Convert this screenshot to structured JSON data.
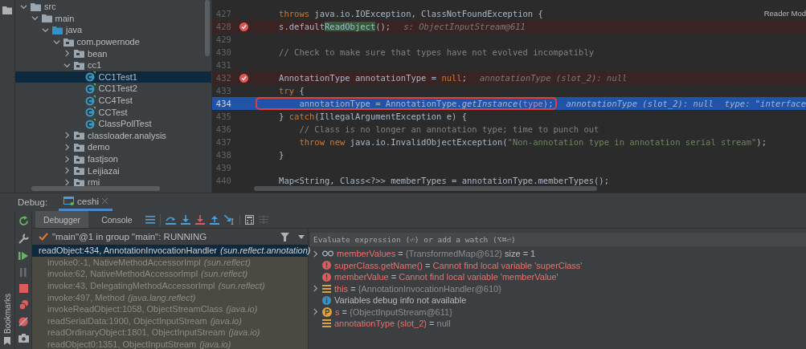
{
  "project_tree": {
    "items": [
      {
        "label": "src",
        "kind": "folder",
        "expanded": true,
        "children": [
          {
            "label": "main",
            "kind": "folder",
            "expanded": true,
            "children": [
              {
                "label": "java",
                "kind": "source_folder",
                "expanded": true,
                "children": [
                  {
                    "label": "com.powernode",
                    "kind": "package",
                    "expanded": true,
                    "children": [
                      {
                        "label": "bean",
                        "kind": "package",
                        "expanded": false,
                        "selected": false
                      },
                      {
                        "label": "cc1",
                        "kind": "package",
                        "expanded": true,
                        "selected": false,
                        "children": [
                          {
                            "label": "CC1Test1",
                            "kind": "class",
                            "selected": true
                          },
                          {
                            "label": "CC1Test2",
                            "kind": "class",
                            "selected": false
                          },
                          {
                            "label": "CC4Test",
                            "kind": "class",
                            "selected": false
                          },
                          {
                            "label": "CCTest",
                            "kind": "class",
                            "selected": false
                          },
                          {
                            "label": "ClassPollTest",
                            "kind": "class",
                            "selected": false
                          }
                        ]
                      },
                      {
                        "label": "classloader.analysis",
                        "kind": "package",
                        "expanded": false,
                        "selected": false
                      },
                      {
                        "label": "demo",
                        "kind": "package",
                        "expanded": false,
                        "selected": false
                      },
                      {
                        "label": "fastjson",
                        "kind": "package",
                        "expanded": false,
                        "selected": false
                      },
                      {
                        "label": "Leijiazai",
                        "kind": "package",
                        "expanded": false,
                        "selected": false
                      },
                      {
                        "label": "rmi",
                        "kind": "package",
                        "expanded": false,
                        "selected": false
                      }
                    ]
                  }
                ]
              }
            ]
          }
        ]
      }
    ]
  },
  "editor": {
    "reader_mode": "Reader Mod",
    "lines": [
      {
        "number": "427",
        "breakpoint": false,
        "current": false,
        "code": [
          {
            "text": "    throws",
            "kind": "keyword"
          },
          {
            "text": " java.io.IOException, ClassNotFoundException {",
            "kind": "plain"
          }
        ]
      },
      {
        "number": "428",
        "breakpoint": true,
        "current": false,
        "code": [
          {
            "text": "    s.default",
            "kind": "plain"
          },
          {
            "text": "ReadObject",
            "kind": "match"
          },
          {
            "text": "();",
            "kind": "plain"
          }
        ],
        "hints": [
          "s: ObjectInputStream@611"
        ]
      },
      {
        "number": "429",
        "breakpoint": false,
        "current": false
      },
      {
        "number": "430",
        "breakpoint": false,
        "current": false,
        "code": [
          {
            "text": "    // Check to make sure that types have not evolved incompatibly",
            "kind": "comment"
          }
        ]
      },
      {
        "number": "431",
        "breakpoint": false,
        "current": false
      },
      {
        "number": "432",
        "breakpoint": true,
        "current": false,
        "code": [
          {
            "text": "    AnnotationType annotationType = ",
            "kind": "plain"
          },
          {
            "text": "null",
            "kind": "keyword"
          },
          {
            "text": ";",
            "kind": "plain"
          }
        ],
        "hints": [
          "annotationType (slot_2): null"
        ]
      },
      {
        "number": "433",
        "breakpoint": false,
        "current": false,
        "code": [
          {
            "text": "    try",
            "kind": "keyword"
          },
          {
            "text": " {",
            "kind": "plain"
          }
        ]
      },
      {
        "number": "434",
        "breakpoint": false,
        "current": true,
        "boxed": true,
        "code": [
          {
            "text": "        annotationType = AnnotationType.",
            "kind": "plain"
          },
          {
            "text": "getInstance",
            "kind": "call"
          },
          {
            "text": "(",
            "kind": "plain"
          },
          {
            "text": "type",
            "kind": "param"
          },
          {
            "text": ");",
            "kind": "plain"
          }
        ],
        "hints": [
          "annotationType (slot_2): null",
          "type: \"interface"
        ]
      },
      {
        "number": "435",
        "breakpoint": false,
        "current": false,
        "code": [
          {
            "text": "    } ",
            "kind": "plain"
          },
          {
            "text": "catch",
            "kind": "keyword"
          },
          {
            "text": "(IllegalArgumentException e) {",
            "kind": "plain"
          }
        ]
      },
      {
        "number": "436",
        "breakpoint": false,
        "current": false,
        "code": [
          {
            "text": "        // Class is no longer an annotation type; time to punch out",
            "kind": "comment"
          }
        ]
      },
      {
        "number": "437",
        "breakpoint": false,
        "current": false,
        "code": [
          {
            "text": "        throw new",
            "kind": "keyword"
          },
          {
            "text": " java.io.InvalidObjectException(",
            "kind": "plain"
          },
          {
            "text": "\"Non-annotation type in annotation serial stream\"",
            "kind": "string"
          },
          {
            "text": ");",
            "kind": "plain"
          }
        ]
      },
      {
        "number": "438",
        "breakpoint": false,
        "current": false,
        "code": [
          {
            "text": "    }",
            "kind": "plain"
          }
        ]
      },
      {
        "number": "439",
        "breakpoint": false,
        "current": false
      },
      {
        "number": "440",
        "breakpoint": false,
        "current": false,
        "code": [
          {
            "text": "    Map<String, Class<?>> memberTypes = annotationType.memberTypes();",
            "kind": "plain"
          }
        ]
      }
    ]
  },
  "debug": {
    "label": "Debug:",
    "tabs": [
      {
        "label": "ceshi",
        "selected": true
      }
    ],
    "subtabs": [
      {
        "label": "Debugger",
        "selected": true
      },
      {
        "label": "Console",
        "selected": false
      }
    ],
    "thread": "\"main\"@1 in group \"main\": RUNNING",
    "frames": [
      {
        "method": "readObject:434, AnnotationInvocationHandler",
        "package": "(sun.reflect.annotation)",
        "selected": true
      },
      {
        "method": "invoke0:-1, NativeMethodAccessorImpl",
        "package": "(sun.reflect)",
        "selected": false
      },
      {
        "method": "invoke:62, NativeMethodAccessorImpl",
        "package": "(sun.reflect)",
        "selected": false
      },
      {
        "method": "invoke:43, DelegatingMethodAccessorImpl",
        "package": "(sun.reflect)",
        "selected": false
      },
      {
        "method": "invoke:497, Method",
        "package": "(java.lang.reflect)",
        "selected": false
      },
      {
        "method": "invokeReadObject:1058, ObjectStreamClass",
        "package": "(java.io)",
        "selected": false
      },
      {
        "method": "readSerialData:1900, ObjectInputStream",
        "package": "(java.io)",
        "selected": false
      },
      {
        "method": "readOrdinaryObject:1801, ObjectInputStream",
        "package": "(java.io)",
        "selected": false
      },
      {
        "method": "readObject0:1351, ObjectInputStream",
        "package": "(java.io)",
        "selected": false
      }
    ],
    "watch_field": {
      "placeholder": "Evaluate expression (⏎) or add a watch (⌥⌘⏎)"
    },
    "variables": [
      {
        "kind": "watch",
        "expandable": true,
        "name": "memberValues",
        "operator": "=",
        "value": "{TransformedMap@612}",
        "extra": "size = 1"
      },
      {
        "kind": "error",
        "expandable": false,
        "name": "superClass.getName()",
        "operator": "=",
        "value": "Cannot find local variable 'superClass'"
      },
      {
        "kind": "error",
        "expandable": false,
        "name": "memberValue",
        "operator": "=",
        "value": "Cannot find local variable 'memberValue'"
      },
      {
        "kind": "field",
        "expandable": true,
        "name": "this",
        "operator": "=",
        "value": "{AnnotationInvocationHandler@610}"
      },
      {
        "kind": "info",
        "expandable": false,
        "name": "Variables debug info not available"
      },
      {
        "kind": "param",
        "expandable": true,
        "name": "s",
        "operator": "=",
        "value": "{ObjectInputStream@611}"
      },
      {
        "kind": "field",
        "expandable": false,
        "name": "annotationType (slot_2)",
        "operator": "=",
        "value": "null"
      }
    ]
  },
  "sidebar_label": "Bookmarks"
}
